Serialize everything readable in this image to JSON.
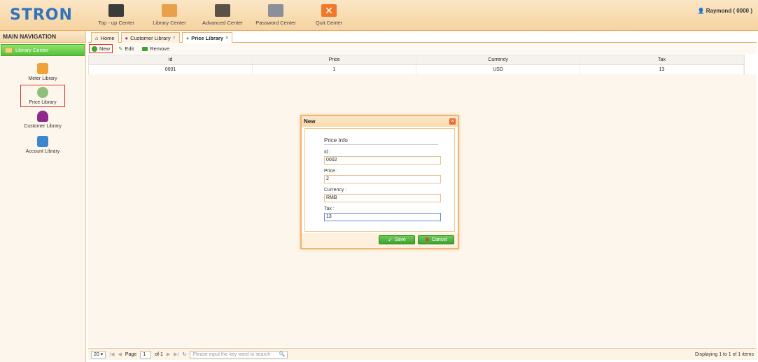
{
  "app": {
    "logo": "STRON",
    "user": "Raymond ( 0000 )"
  },
  "topnav": [
    {
      "label": "Top - up Center",
      "icon": "topup-icon",
      "color": "#3b3b3b"
    },
    {
      "label": "Library Center",
      "icon": "library-icon",
      "color": "#e9a149"
    },
    {
      "label": "Advanced Center",
      "icon": "advanced-icon",
      "color": "#5a5147"
    },
    {
      "label": "Password Center",
      "icon": "password-icon",
      "color": "#8a8f99"
    },
    {
      "label": "Quit Center",
      "icon": "quit-icon",
      "color": "#f07a2c"
    }
  ],
  "sidebar": {
    "title": "MAIN NAVIGATION",
    "group": "Library Center",
    "items": [
      {
        "label": "Meter Library",
        "icon": "meter-icon",
        "color": "#f0a23a"
      },
      {
        "label": "Price Library",
        "icon": "price-icon",
        "color": "#8fbf7a"
      },
      {
        "label": "Customer Library",
        "icon": "customer-icon",
        "color": "#8f2a8a"
      },
      {
        "label": "Account Library",
        "icon": "account-icon",
        "color": "#3d86cf"
      }
    ]
  },
  "tabs": [
    {
      "label": "Home",
      "icon": "home-icon"
    },
    {
      "label": "Customer Library",
      "icon": "customer-icon"
    },
    {
      "label": "Price Library",
      "icon": "price-icon"
    }
  ],
  "tab_close": "×",
  "toolbar": {
    "new": "New",
    "edit": "Edit",
    "remove": "Remove"
  },
  "grid": {
    "columns": [
      "Id",
      "Price",
      "Currency",
      "Tax"
    ],
    "rows": [
      [
        "0001",
        "1",
        "USD",
        "13"
      ]
    ]
  },
  "pager": {
    "page_size": "20",
    "page_label": "Page",
    "page": "1",
    "of": "of 1",
    "search_placeholder": "Please input the key word to search",
    "display": "Displaying 1 to 1 of 1 items"
  },
  "dialog": {
    "title": "New",
    "fieldset": "Price Info",
    "fields": [
      {
        "label": "Id :",
        "value": "0002"
      },
      {
        "label": "Price :",
        "value": "2"
      },
      {
        "label": "Currency :",
        "value": "RMB"
      },
      {
        "label": "Tax :",
        "value": "13"
      }
    ],
    "save": "Save",
    "cancel": "Cancel"
  }
}
